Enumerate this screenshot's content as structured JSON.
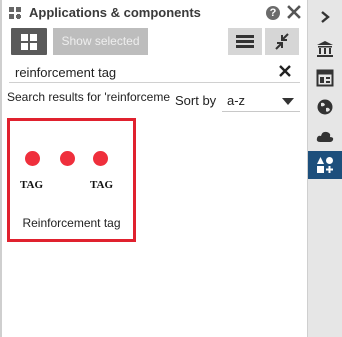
{
  "header": {
    "title": "Applications & components",
    "icons": [
      "apps-components-icon",
      "help-icon",
      "close-icon"
    ],
    "help_glyph": "?"
  },
  "toolbar": {
    "show_selected_label": "Show selected",
    "icons": [
      "grid-view-icon",
      "list-menu-icon",
      "collapse-icon"
    ]
  },
  "search": {
    "value": "reinforcement tag",
    "clear_icon": "close-icon"
  },
  "results": {
    "text": "Search results for 'reinforcement tag'",
    "sort_label": "Sort by",
    "sort_value": "a-z"
  },
  "cards": [
    {
      "name": "Reinforcement tag",
      "thumbnail_labels": [
        "TAG",
        "TAG"
      ],
      "selected": true
    }
  ],
  "right_sidebar": {
    "items": [
      {
        "icon": "chevron-right-icon",
        "active": false
      },
      {
        "icon": "bank-icon",
        "active": false
      },
      {
        "icon": "layout-icon",
        "active": false
      },
      {
        "icon": "globe-icon",
        "active": false
      },
      {
        "icon": "cloud-icon",
        "active": false
      },
      {
        "icon": "apps-add-icon",
        "active": true
      }
    ]
  },
  "colors": {
    "accent_red": "#e0212e",
    "dot_red": "#ef2f3c",
    "active_blue": "#1d4f7c",
    "button_dark": "#5a5a5a",
    "button_light": "#d6d6d6",
    "disabled_button": "#bdbdbd"
  }
}
